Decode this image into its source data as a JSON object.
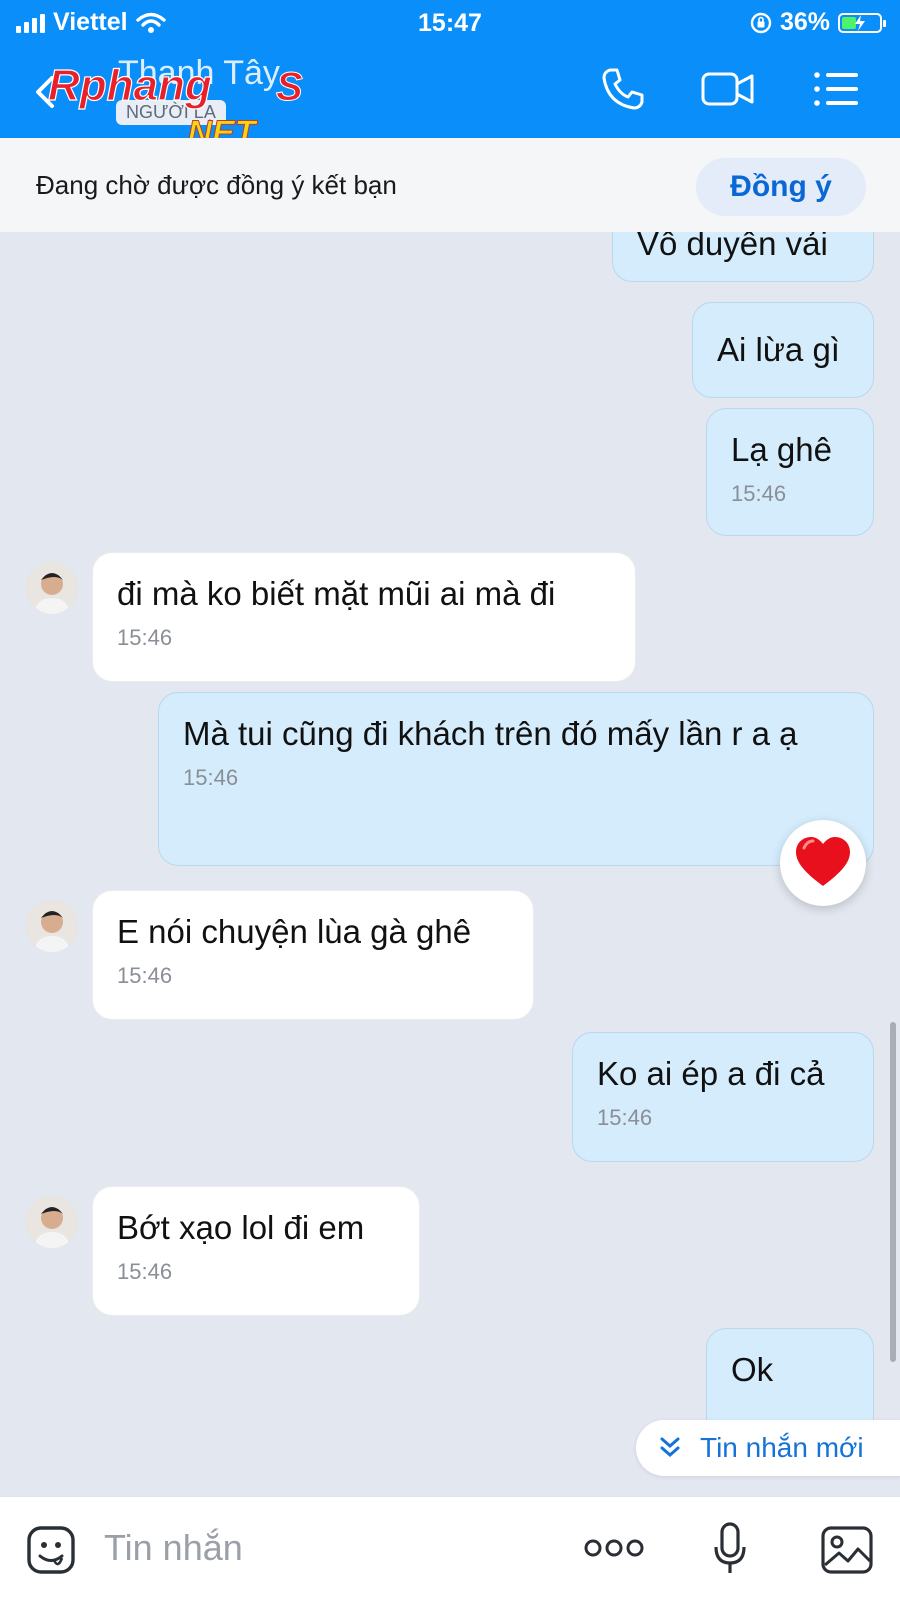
{
  "status_bar": {
    "carrier": "Viettel",
    "time": "15:47",
    "battery": "36%",
    "battery_level": 0.36
  },
  "header": {
    "contact_name": "Thanh Tây",
    "stranger_tag": "NGƯỜI LẠ",
    "watermark": "Rphang S .NET"
  },
  "invite_bar": {
    "text": "Đang chờ được đồng ý kết bạn",
    "accept_label": "Đồng ý"
  },
  "messages": [
    {
      "dir": "out",
      "text": "Vô duyên vải",
      "time": ""
    },
    {
      "dir": "out",
      "text": "Ai lừa gì",
      "time": ""
    },
    {
      "dir": "out",
      "text": "Lạ ghê",
      "time": "15:46"
    },
    {
      "dir": "in",
      "text": "đi mà ko biết mặt mũi ai mà đi",
      "time": "15:46"
    },
    {
      "dir": "out",
      "text": "Mà tui cũng đi khách trên đó mấy lần r a ạ",
      "time": "15:46",
      "reaction": "heart"
    },
    {
      "dir": "in",
      "text": "E nói chuyện lùa gà ghê",
      "time": "15:46"
    },
    {
      "dir": "out",
      "text": "Ko ai ép a đi cả",
      "time": "15:46"
    },
    {
      "dir": "in",
      "text": "Bớt xạo lol đi em",
      "time": "15:46"
    },
    {
      "dir": "out",
      "text": "Ok",
      "time": ""
    }
  ],
  "new_messages_label": "Tin nhắn mới",
  "composer": {
    "placeholder": "Tin nhắn"
  },
  "colors": {
    "header": "#0a8ef9",
    "outgoing_bubble": "#d4ecfc",
    "incoming_bubble": "#ffffff",
    "background": "#e3e7ef"
  }
}
